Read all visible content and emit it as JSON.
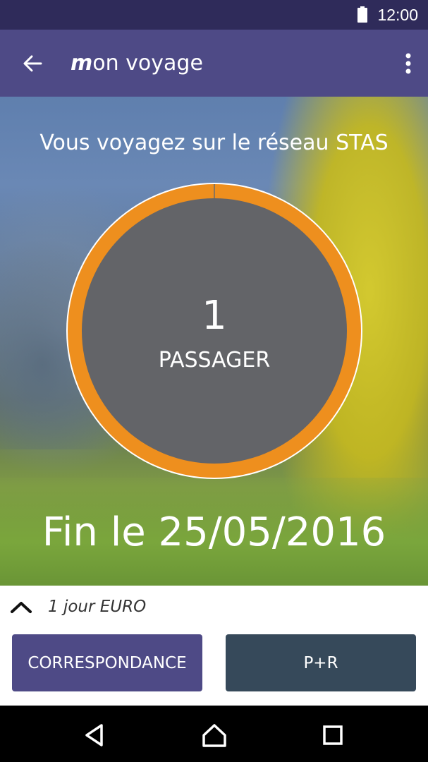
{
  "status_bar": {
    "time": "12:00"
  },
  "app_bar": {
    "title_initial": "m",
    "title_rest": "on voyage"
  },
  "hero": {
    "network_text": "Vous voyagez sur le réseau STAS",
    "passenger_count": "1",
    "passenger_label": "PASSAGER",
    "end_date": "Fin le 25/05/2016",
    "ring_colors": {
      "fill": "#ee8f1e",
      "inner": "#636468",
      "border": "#ffffff"
    }
  },
  "panel": {
    "ticket_name": "1 jour EURO",
    "correspondance_label": "CORRESPONDANCE",
    "pr_label": "P+R"
  },
  "colors": {
    "primary": "#4e4a86",
    "status": "#2f2b5a",
    "secondary_button": "#36495a"
  }
}
